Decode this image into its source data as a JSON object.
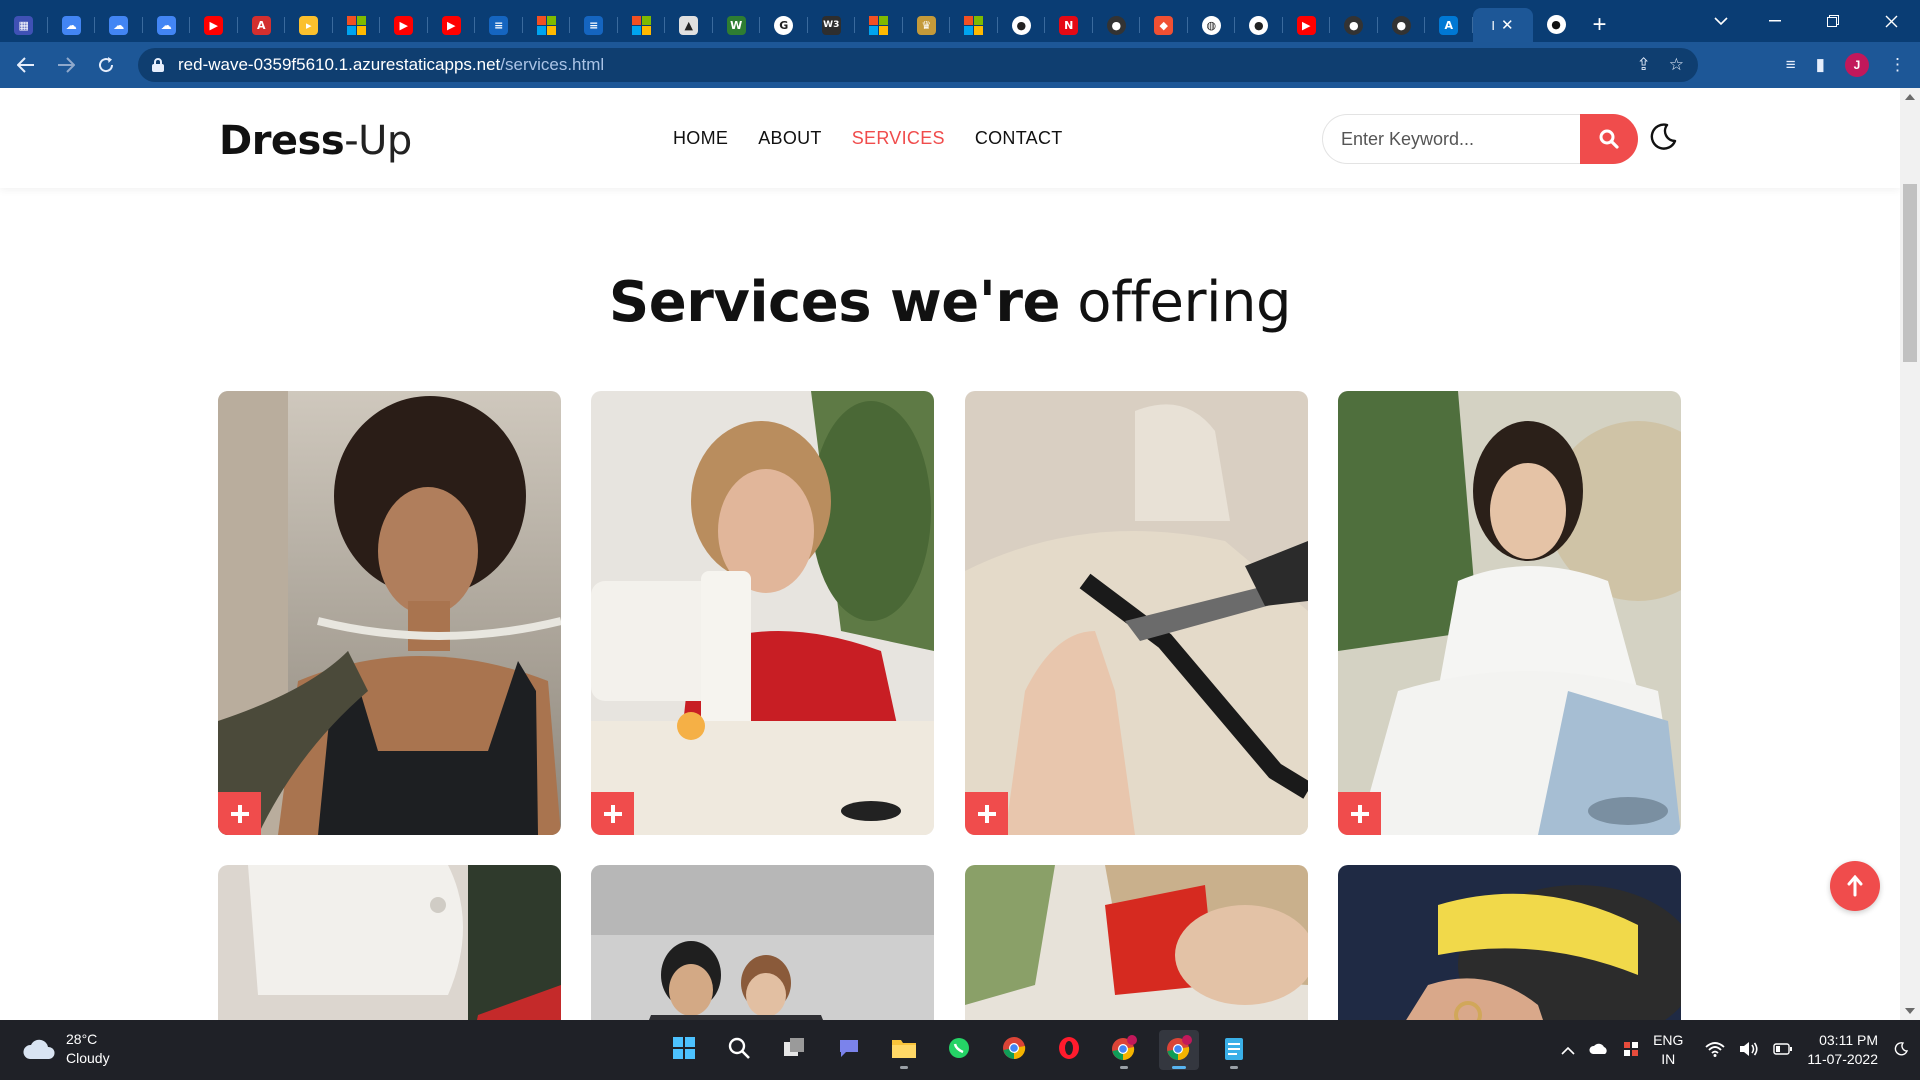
{
  "browser": {
    "tabs": [
      {
        "icon": "dashboard-icon",
        "color": "#3f51b5",
        "glyph": "▦"
      },
      {
        "icon": "google-cloud-icon",
        "color": "#4285f4",
        "glyph": "☁"
      },
      {
        "icon": "google-cloud-icon",
        "color": "#4285f4",
        "glyph": "☁"
      },
      {
        "icon": "google-cloud-icon",
        "color": "#4285f4",
        "glyph": "☁"
      },
      {
        "icon": "youtube-icon",
        "color": "#ff0000",
        "glyph": "▶"
      },
      {
        "icon": "app-icon",
        "color": "#d32f2f",
        "glyph": "A"
      },
      {
        "icon": "play-icon",
        "color": "#fbc02d",
        "glyph": "▸"
      },
      {
        "icon": "microsoft-icon",
        "color": "",
        "glyph": ""
      },
      {
        "icon": "youtube-icon",
        "color": "#ff0000",
        "glyph": "▶"
      },
      {
        "icon": "youtube-icon",
        "color": "#ff0000",
        "glyph": "▶"
      },
      {
        "icon": "doc-icon",
        "color": "#1565c0",
        "glyph": "≡"
      },
      {
        "icon": "microsoft-icon",
        "color": "",
        "glyph": ""
      },
      {
        "icon": "doc-icon",
        "color": "#1565c0",
        "glyph": "≡"
      },
      {
        "icon": "microsoft-icon",
        "color": "",
        "glyph": ""
      },
      {
        "icon": "mountain-icon",
        "color": "#e0e0e0",
        "glyph": "▲"
      },
      {
        "icon": "w-icon",
        "color": "#2e7d32",
        "glyph": "W"
      },
      {
        "icon": "google-icon",
        "color": "#ffffff",
        "glyph": "G"
      },
      {
        "icon": "w3schools-icon",
        "color": "#2e2e2e",
        "glyph": "W3"
      },
      {
        "icon": "microsoft-icon",
        "color": "",
        "glyph": ""
      },
      {
        "icon": "crown-icon",
        "color": "#c49a3a",
        "glyph": "♛"
      },
      {
        "icon": "microsoft-icon",
        "color": "",
        "glyph": ""
      },
      {
        "icon": "github-icon",
        "color": "#ffffff",
        "glyph": "●"
      },
      {
        "icon": "netflix-icon",
        "color": "#e50914",
        "glyph": "N"
      },
      {
        "icon": "github-icon",
        "color": "#333333",
        "glyph": "●"
      },
      {
        "icon": "git-icon",
        "color": "#f05033",
        "glyph": "◆"
      },
      {
        "icon": "globe-icon",
        "color": "#ffffff",
        "glyph": "◍"
      },
      {
        "icon": "github-icon",
        "color": "#ffffff",
        "glyph": "●"
      },
      {
        "icon": "youtube-icon",
        "color": "#ff0000",
        "glyph": "▶"
      },
      {
        "icon": "github-icon",
        "color": "#333333",
        "glyph": "●"
      },
      {
        "icon": "github-icon",
        "color": "#333333",
        "glyph": "●"
      },
      {
        "icon": "azure-icon",
        "color": "#0078d4",
        "glyph": "A"
      }
    ],
    "active_tab_label": "I",
    "address": {
      "host": "red-wave-0359f5610.1.azurestaticapps.net",
      "path": "/services.html"
    }
  },
  "site": {
    "logo_bold": "Dress",
    "logo_light": "-Up",
    "nav": [
      {
        "label": "HOME",
        "active": false
      },
      {
        "label": "ABOUT",
        "active": false
      },
      {
        "label": "SERVICES",
        "active": true
      },
      {
        "label": "CONTACT",
        "active": false
      }
    ],
    "search_placeholder": "Enter Keyword...",
    "title_bold": "Services we're",
    "title_light": " offering",
    "accent_color": "#f04c4c",
    "cards": [
      {
        "name": "measuring-tape-model",
        "scene": "woman with curly hair being measured with a tape"
      },
      {
        "name": "sewing-machine-woman",
        "scene": "woman in red sweater sewing on a machine"
      },
      {
        "name": "mannequin-cutting",
        "scene": "hands cutting fabric on a dress form with scissors"
      },
      {
        "name": "hand-stitching",
        "scene": "woman hand stitching white fabric"
      },
      {
        "name": "sewing-machine-closeup",
        "scene": "close-up of a white sewing machine"
      },
      {
        "name": "tailors-at-work",
        "scene": "two tailors working at a table"
      },
      {
        "name": "red-shirt-tailor",
        "scene": "tailor in red shirt leaning over fabric"
      },
      {
        "name": "measuring-tape-wrist",
        "scene": "yellow measuring tape wrapped on hand"
      }
    ]
  },
  "taskbar": {
    "temperature": "28°C",
    "condition": "Cloudy",
    "apps": [
      {
        "icon": "windows-start-icon",
        "active": false,
        "running": false
      },
      {
        "icon": "search-icon",
        "active": false,
        "running": false
      },
      {
        "icon": "task-view-icon",
        "active": false,
        "running": false
      },
      {
        "icon": "teams-chat-icon",
        "active": false,
        "running": false
      },
      {
        "icon": "file-explorer-icon",
        "active": false,
        "running": true
      },
      {
        "icon": "whatsapp-icon",
        "active": false,
        "running": false
      },
      {
        "icon": "chrome-icon",
        "active": false,
        "running": false
      },
      {
        "icon": "opera-icon",
        "active": false,
        "running": false
      },
      {
        "icon": "chrome-profile-icon",
        "active": false,
        "running": true
      },
      {
        "icon": "chrome-profile-icon",
        "active": true,
        "running": true
      },
      {
        "icon": "notepad-icon",
        "active": false,
        "running": true
      }
    ],
    "lang_1": "ENG",
    "lang_2": "IN",
    "time": "03:11 PM",
    "date": "11-07-2022"
  },
  "profile_initial": "J"
}
